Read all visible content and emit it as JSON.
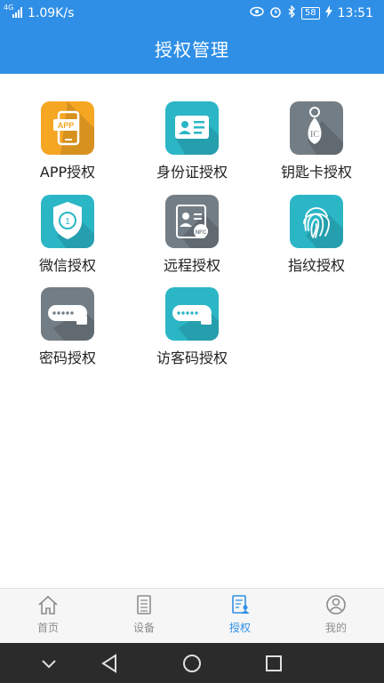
{
  "status": {
    "network_type": "4G",
    "speed": "1.09K/s",
    "battery": "58",
    "time": "13:51"
  },
  "header": {
    "title": "授权管理"
  },
  "grid": {
    "items": [
      {
        "label": "APP授权",
        "icon": "app-icon",
        "color": "#f5a623"
      },
      {
        "label": "身份证授权",
        "icon": "id-card-icon",
        "color": "#2bb6c6"
      },
      {
        "label": "钥匙卡授权",
        "icon": "key-card-icon",
        "color": "#737d85"
      },
      {
        "label": "微信授权",
        "icon": "wechat-shield-icon",
        "color": "#2bb6c6"
      },
      {
        "label": "远程授权",
        "icon": "remote-nfc-icon",
        "color": "#737d85"
      },
      {
        "label": "指纹授权",
        "icon": "fingerprint-icon",
        "color": "#2bb6c6"
      },
      {
        "label": "密码授权",
        "icon": "password-lock-icon",
        "color": "#737d85"
      },
      {
        "label": "访客码授权",
        "icon": "visitor-code-icon",
        "color": "#2bb6c6"
      }
    ]
  },
  "tabbar": {
    "tabs": [
      {
        "label": "首页",
        "icon": "home-icon"
      },
      {
        "label": "设备",
        "icon": "device-icon"
      },
      {
        "label": "授权",
        "icon": "authorization-icon",
        "active": true
      },
      {
        "label": "我的",
        "icon": "profile-icon"
      }
    ]
  },
  "colors": {
    "primary": "#2f8fe6"
  }
}
